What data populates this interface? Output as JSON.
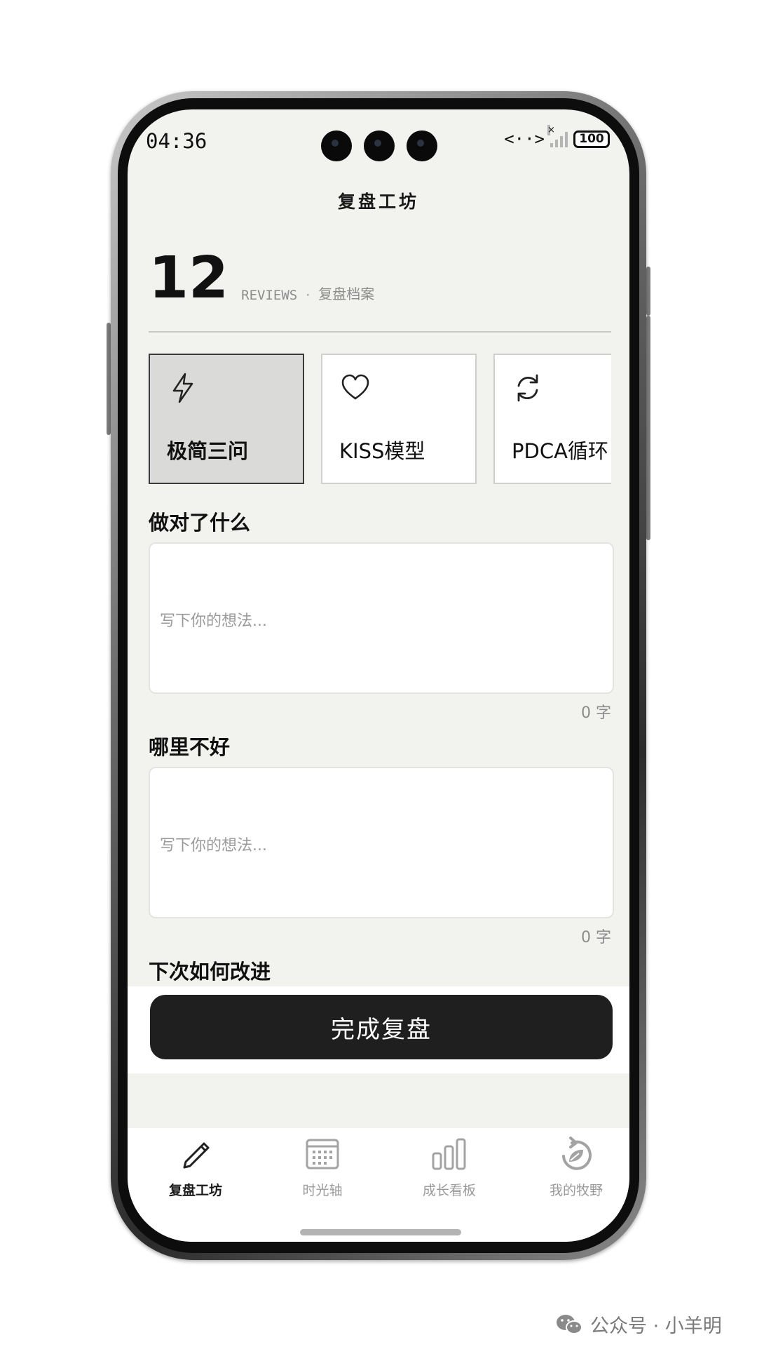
{
  "status_bar": {
    "time": "04:36",
    "arrows": "<··>",
    "signal_mark": "×",
    "battery": "100"
  },
  "app": {
    "title": "复盘工坊"
  },
  "stats": {
    "count": "12",
    "label": "REVIEWS",
    "separator": "·",
    "subtitle": "复盘档案"
  },
  "models": [
    {
      "label": "极简三问",
      "icon": "lightning-icon",
      "active": true
    },
    {
      "label": "KISS模型",
      "icon": "heart-icon",
      "active": false
    },
    {
      "label": "PDCA循环",
      "icon": "refresh-icon",
      "active": false
    }
  ],
  "questions": [
    {
      "title": "做对了什么",
      "placeholder": "写下你的想法...",
      "count": "0 字"
    },
    {
      "title": "哪里不好",
      "placeholder": "写下你的想法...",
      "count": "0 字"
    },
    {
      "title": "下次如何改进"
    }
  ],
  "actions": {
    "finish_label": "完成复盘"
  },
  "tabs": [
    {
      "label": "复盘工坊",
      "icon": "pencil-icon",
      "active": true
    },
    {
      "label": "时光轴",
      "icon": "calendar-icon",
      "active": false
    },
    {
      "label": "成长看板",
      "icon": "bar-chart-icon",
      "active": false
    },
    {
      "label": "我的牧野",
      "icon": "leaf-cycle-icon",
      "active": false
    }
  ],
  "watermark": {
    "text": "公众号 · 小羊明"
  },
  "colors": {
    "screen_bg": "#f2f2ef",
    "active_card_bg": "#dadad8",
    "primary_button": "#1f1f1f",
    "muted_text": "#9a9a9a"
  }
}
